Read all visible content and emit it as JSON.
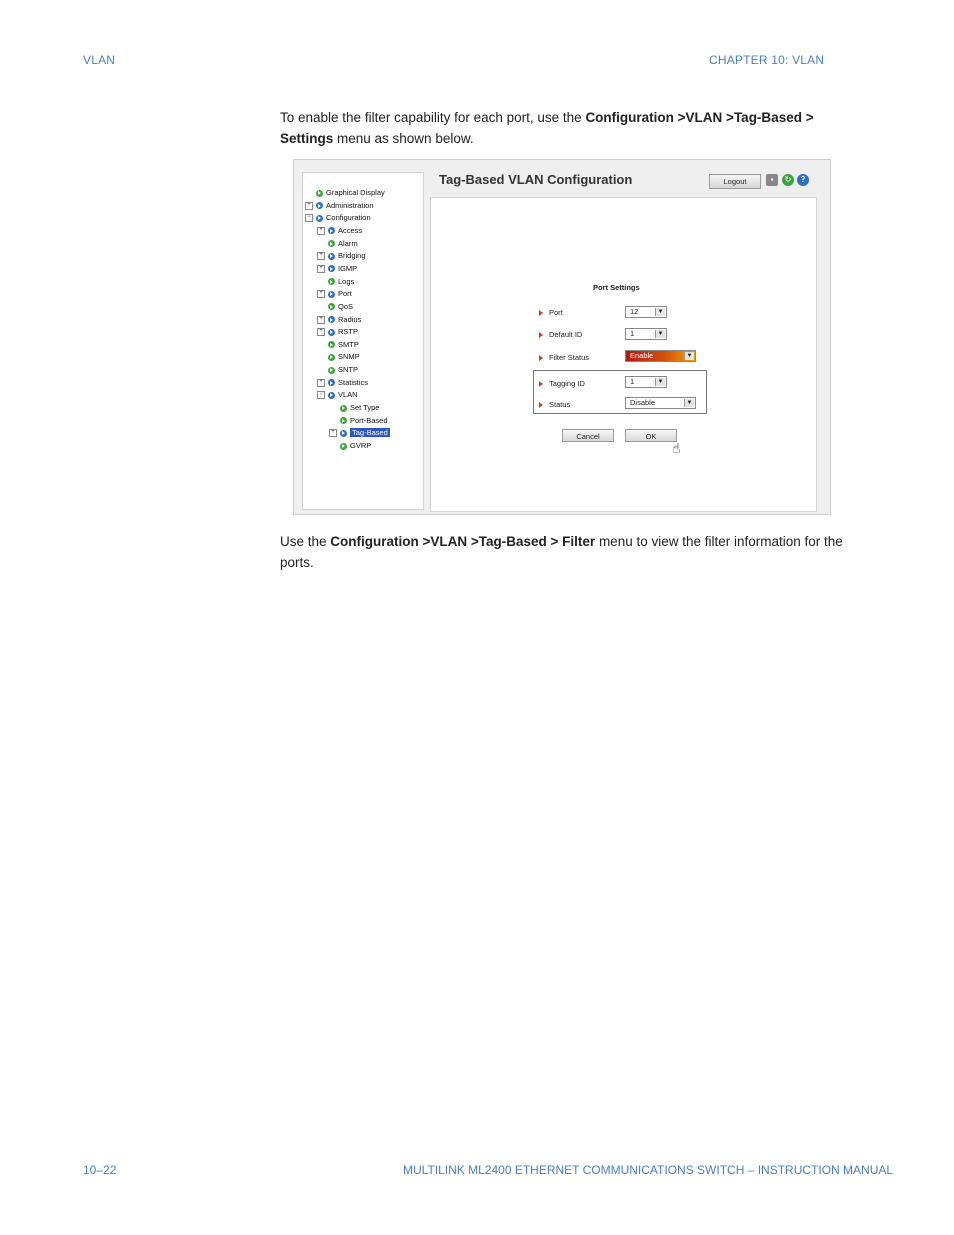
{
  "header": {
    "left": "VLAN",
    "right": "CHAPTER 10: VLAN"
  },
  "intro": {
    "pre": "To enable the filter capability for each port, use the ",
    "bold": "Configuration >VLAN >Tag-Based > Settings",
    "post": " menu as shown below."
  },
  "screenshot": {
    "title": "Tag-Based VLAN Configuration",
    "logout_label": "Logout",
    "tree": [
      {
        "label": "Graphical Display",
        "expander": "",
        "icon": "green-arrow"
      },
      {
        "label": "Administration",
        "expander": "+",
        "icon": "blue-arrow"
      },
      {
        "label": "Configuration",
        "expander": "−",
        "icon": "blue-arrow"
      },
      {
        "label": "Access",
        "expander": "+",
        "icon": "blue-arrow"
      },
      {
        "label": "Alarm",
        "expander": "",
        "icon": "green-arrow"
      },
      {
        "label": "Bridging",
        "expander": "+",
        "icon": "blue-arrow"
      },
      {
        "label": "IGMP",
        "expander": "+",
        "icon": "blue-arrow"
      },
      {
        "label": "Logs",
        "expander": "",
        "icon": "green-arrow"
      },
      {
        "label": "Port",
        "expander": "+",
        "icon": "blue-arrow"
      },
      {
        "label": "QoS",
        "expander": "",
        "icon": "green-arrow"
      },
      {
        "label": "Radius",
        "expander": "+",
        "icon": "blue-arrow"
      },
      {
        "label": "RSTP",
        "expander": "+",
        "icon": "blue-arrow"
      },
      {
        "label": "SMTP",
        "expander": "",
        "icon": "green-arrow"
      },
      {
        "label": "SNMP",
        "expander": "",
        "icon": "green-arrow"
      },
      {
        "label": "SNTP",
        "expander": "",
        "icon": "green-arrow"
      },
      {
        "label": "Statistics",
        "expander": "+",
        "icon": "blue-arrow"
      },
      {
        "label": "VLAN",
        "expander": "−",
        "icon": "blue-arrow"
      },
      {
        "label": "Set Type",
        "expander": "",
        "icon": "green-arrow"
      },
      {
        "label": "Port-Based",
        "expander": "",
        "icon": "green-arrow"
      },
      {
        "label": "Tag-Based",
        "expander": "+",
        "icon": "blue-arrow",
        "selected": true
      },
      {
        "label": "GVRP",
        "expander": "",
        "icon": "green-arrow"
      }
    ],
    "port_settings": {
      "title": "Port Settings",
      "port_label": "Port",
      "port_value": "12",
      "default_id_label": "Default ID",
      "default_id_value": "1",
      "filter_status_label": "Filter Status",
      "filter_status_value": "Enable",
      "tagging_id_label": "Tagging ID",
      "tagging_id_value": "1",
      "status_label": "Status",
      "status_value": "Disable",
      "cancel_label": "Cancel",
      "ok_label": "OK"
    }
  },
  "outro": {
    "pre": "Use the ",
    "bold": "Configuration >VLAN >Tag-Based > Filter",
    "post": " menu to view the filter information for the ports."
  },
  "footer": {
    "left": "10–22",
    "right": "MULTILINK ML2400 ETHERNET COMMUNICATIONS SWITCH – INSTRUCTION MANUAL"
  },
  "colors": {
    "accent": "#4a7fc1",
    "enable_start": "#b01a12",
    "enable_end": "#f0a400"
  }
}
